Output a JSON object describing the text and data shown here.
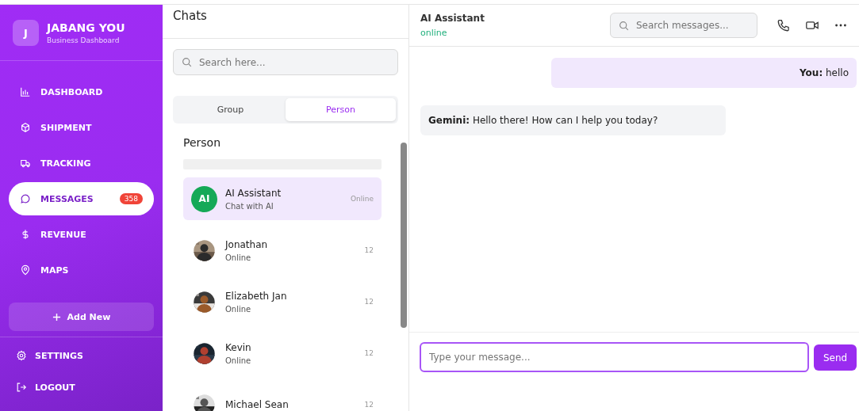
{
  "brand": {
    "initial": "J",
    "name": "JABANG YOU",
    "subtitle": "Business Dashboard"
  },
  "nav": [
    {
      "label": "DASHBOARD",
      "kind": "chart",
      "selected": false
    },
    {
      "label": "SHIPMENT",
      "kind": "box",
      "selected": false
    },
    {
      "label": "TRACKING",
      "kind": "truck",
      "selected": false
    },
    {
      "label": "MESSAGES",
      "kind": "chat",
      "selected": true,
      "badge": "358"
    },
    {
      "label": "REVENUE",
      "kind": "dollar",
      "selected": false
    },
    {
      "label": "MAPS",
      "kind": "pin",
      "selected": false
    }
  ],
  "add_button": "Add New",
  "footer": [
    {
      "label": "SETTINGS",
      "kind": "gear"
    },
    {
      "label": "LOGOUT",
      "kind": "logout"
    }
  ],
  "chats": {
    "title": "Chats",
    "search": {
      "placeholder": "Search here..."
    },
    "tabs": [
      {
        "label": "Group",
        "selected": false
      },
      {
        "label": "Person",
        "selected": true
      }
    ],
    "section": "Person",
    "contacts": [
      {
        "kind": "initials",
        "initials": "AI",
        "name": "AI Assistant",
        "subtitle": "Chat with AI",
        "meta": "Online",
        "selected": true
      },
      {
        "name": "Jonathan",
        "subtitle": "Online",
        "meta": "12",
        "selected": false
      },
      {
        "name": "Elizabeth Jan",
        "subtitle": "Online",
        "meta": "12",
        "selected": false
      },
      {
        "name": "Kevin",
        "subtitle": "Online",
        "meta": "12",
        "selected": false
      },
      {
        "name": "Michael Sean",
        "meta": "12",
        "selected": false
      }
    ]
  },
  "conversation": {
    "name": "AI Assistant",
    "status": "online",
    "search": {
      "placeholder": "Search messages..."
    },
    "messages": [
      {
        "text": "**You:** hello",
        "mine": true
      },
      {
        "text": "**Gemini:** Hello there! How can I help you today?",
        "mine": false
      }
    ],
    "composer": {
      "placeholder": "Type your message...",
      "send": "Send"
    }
  }
}
